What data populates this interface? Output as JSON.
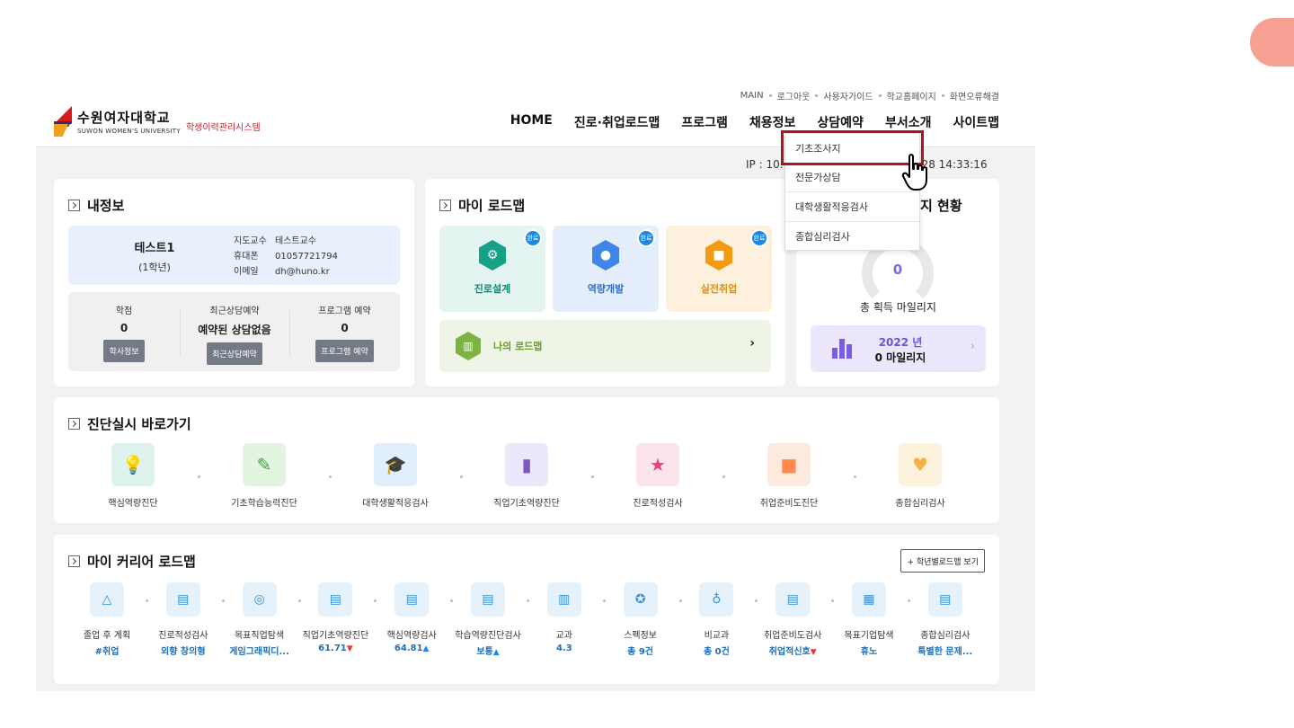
{
  "header": {
    "logo_ko": "수원여자대학교",
    "logo_en": "SUWON WOMEN'S UNIVERSITY",
    "system_name": "학생이력관리시스템",
    "util_links": [
      "MAIN",
      "로그아웃",
      "사용자가이드",
      "학교홈페이지",
      "화면오류해결"
    ],
    "nav": [
      "HOME",
      "진로·취업로드맵",
      "프로그램",
      "채용정보",
      "상담예약",
      "부서소개",
      "사이트맵"
    ]
  },
  "ip_line": {
    "left": "IP : 10.",
    "right": "02-28 14:33:16"
  },
  "dropdown": {
    "items": [
      "기초조사지",
      "전문가상담",
      "대학생활적응검사",
      "종합심리검사"
    ]
  },
  "my_info": {
    "title": "내정보",
    "name": "테스트1",
    "grade": "(1학년)",
    "advisor_label": "지도교수",
    "advisor": "테스트교수",
    "phone_label": "휴대폰",
    "phone": "01057721794",
    "email_label": "이메일",
    "email": "dh@huno.kr",
    "stats": [
      {
        "label": "학점",
        "value": "0",
        "button": "학사정보"
      },
      {
        "label": "최근상담예약",
        "value": "예약된 상담없음",
        "button": "최근상담예약"
      },
      {
        "label": "프로그램 예약",
        "value": "0",
        "button": "프로그램 예약"
      }
    ]
  },
  "my_roadmap": {
    "title": "마이 로드맵",
    "badge": "완료",
    "tiles": [
      {
        "label": "진로설계",
        "bg": "#e3f4f1",
        "color": "#16a085",
        "text_color": "#0f8a72"
      },
      {
        "label": "역량개발",
        "bg": "#e4effb",
        "color": "#3f86e8",
        "text_color": "#2f6fc9"
      },
      {
        "label": "실전취업",
        "bg": "#fdf1de",
        "color": "#f39c12",
        "text_color": "#e08e0b"
      }
    ],
    "my_road_label": "나의 로드맵"
  },
  "mileage": {
    "title_tail": "지 현황",
    "value": "0",
    "label": "총 획득 마일리지",
    "year": "2022 년",
    "year_value": "0 마일리지"
  },
  "diagnosis": {
    "title": "진단실시 바로가기",
    "items": [
      {
        "label": "핵심역량진단",
        "bg": "#dff3ee",
        "color": "#26a69a",
        "icon": "lightbulb-icon"
      },
      {
        "label": "기초학습능력진단",
        "bg": "#e3f4e0",
        "color": "#43a047",
        "icon": "pencil-icon"
      },
      {
        "label": "대학생활적응검사",
        "bg": "#e1eefb",
        "color": "#1e88e5",
        "icon": "graduation-cap-icon"
      },
      {
        "label": "직업기초역량진단",
        "bg": "#ece8fb",
        "color": "#7e57c2",
        "icon": "bar-chart-icon"
      },
      {
        "label": "진로적성검사",
        "bg": "#fce4ec",
        "color": "#ec407a",
        "icon": "star-badge-icon"
      },
      {
        "label": "취업준비도진단",
        "bg": "#fdeadf",
        "color": "#ff8a50",
        "icon": "briefcase-icon"
      },
      {
        "label": "종합심리검사",
        "bg": "#fdf3dc",
        "color": "#f5b041",
        "icon": "heart-head-icon"
      }
    ]
  },
  "career_roadmap": {
    "title": "마이 커리어 로드맵",
    "button": "+ 학년별로드맵 보기",
    "items": [
      {
        "label": "졸업 후 계획",
        "value": "#취업",
        "icon": "tent-icon",
        "arrow": ""
      },
      {
        "label": "진로적성검사",
        "value": "외향 창의형",
        "icon": "clipboard-icon",
        "arrow": ""
      },
      {
        "label": "목표직업탐색",
        "value": "게임그래픽디...",
        "icon": "target-icon",
        "arrow": ""
      },
      {
        "label": "직업기초역량진단",
        "value": "61.71",
        "icon": "clipboard-icon",
        "arrow": "down"
      },
      {
        "label": "핵심역량검사",
        "value": "64.81",
        "icon": "clipboard-icon",
        "arrow": "up"
      },
      {
        "label": "학습역량진단검사",
        "value": "보통",
        "icon": "clipboard-icon",
        "arrow": "up"
      },
      {
        "label": "교과",
        "value": "4.3",
        "icon": "book-icon",
        "arrow": ""
      },
      {
        "label": "스펙정보",
        "value": "총 9건",
        "icon": "star-circle-icon",
        "arrow": ""
      },
      {
        "label": "비교과",
        "value": "총 0건",
        "icon": "lightbulb-icon",
        "arrow": ""
      },
      {
        "label": "취업준비도검사",
        "value": "취업적신호",
        "icon": "clipboard-icon",
        "arrow": "down"
      },
      {
        "label": "목표기업탐색",
        "value": "휴노",
        "icon": "building-icon",
        "arrow": ""
      },
      {
        "label": "종합심리검사",
        "value": "특별한 문제...",
        "icon": "clipboard-icon",
        "arrow": ""
      }
    ]
  }
}
